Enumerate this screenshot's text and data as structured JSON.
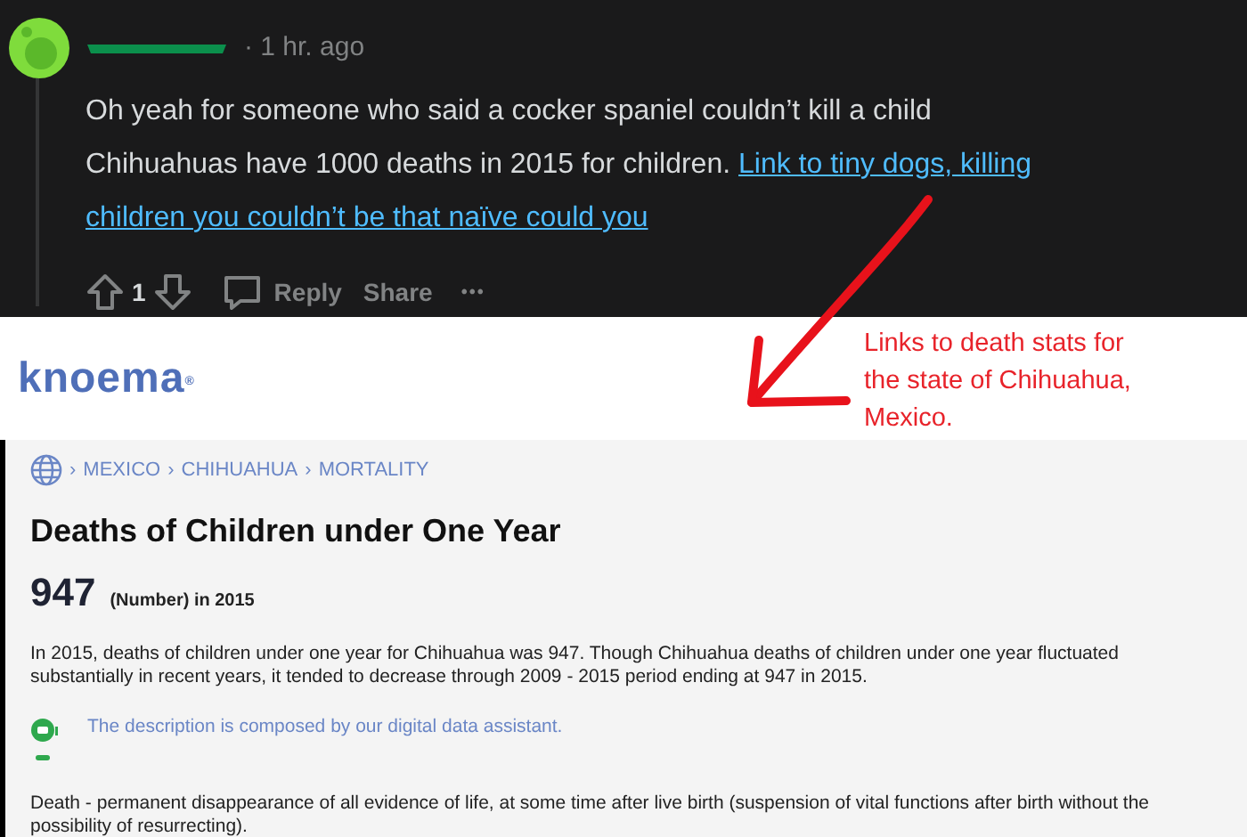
{
  "comment": {
    "time": "· 1 hr. ago",
    "body_lines": [
      "Oh yeah for someone who said a cocker spaniel couldn’t kill a child",
      "Chihuahuas have 1000 deaths in 2015 for children."
    ],
    "link_lines": [
      "Link to tiny dogs, killing",
      "children you couldn’t be that naïve could you"
    ],
    "score": "1",
    "actions": [
      {
        "kind": "reply",
        "label": "Reply"
      },
      {
        "kind": "share",
        "label": "Share"
      },
      {
        "kind": "more",
        "label": "•••"
      }
    ]
  },
  "annotation": {
    "lines": [
      "Links to death stats for",
      "the state of Chihuahua,",
      "Mexico."
    ]
  },
  "page": {
    "logo": "knoema$^{®}$",
    "breadcrumb": [
      "MEXICO",
      "CHIHUAHUA",
      "MORTALITY"
    ],
    "separator": "›",
    "title": "Deaths of Children under One Year",
    "value": "947",
    "unit": "(Number) in 2015",
    "description": "In 2015, deaths of children under one year for Chihuahua was 947. Though Chihuahua deaths of children under one year fluctuated substantially in recent years, it tended to decrease through 2009 - 2015 period ending at 947 in 2015.",
    "assistant_note": "The description is composed by our digital data assistant.",
    "definition": "Death - permanent disappearance of all evidence of life, at some time after live birth (suspension of vital functions after birth without the possibility of resurrecting)."
  }
}
